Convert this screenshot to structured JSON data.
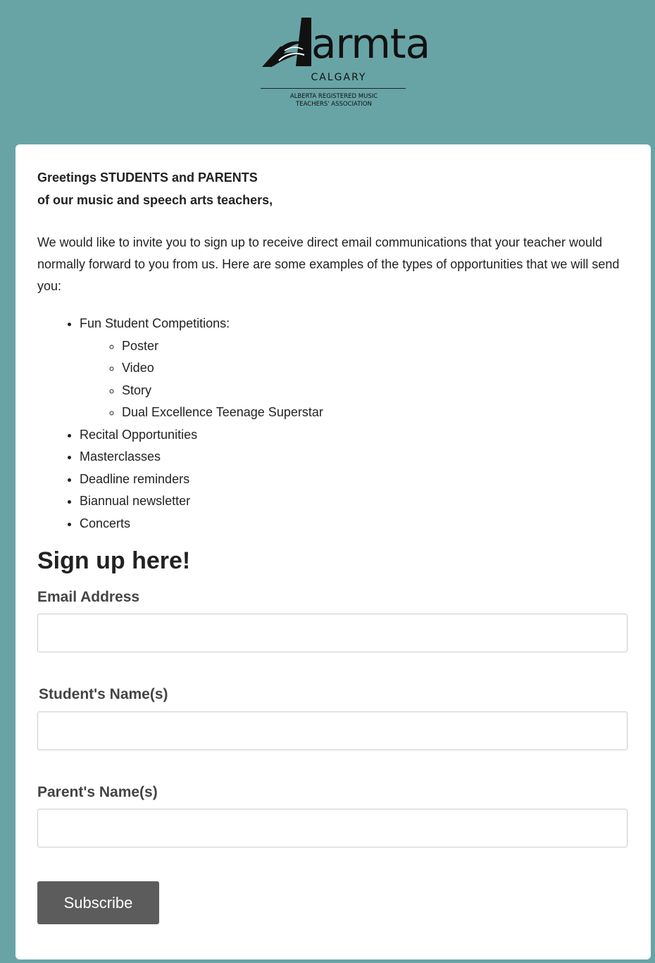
{
  "logo": {
    "wordmark": "armta",
    "city": "CALGARY",
    "association_line1": "ALBERTA REGISTERED MUSIC",
    "association_line2": "TEACHERS' ASSOCIATION",
    "icon": "armta-music-logo-icon"
  },
  "intro": {
    "greeting_line1": "Greetings STUDENTS and PARENTS",
    "greeting_line2": "of our music and speech arts teachers,",
    "paragraph": "We would like to invite you to sign up to receive direct email communications that your teacher would normally forward to you from us. Here are some examples of the types of opportunities that we will send you:"
  },
  "opportunities": {
    "competitions": {
      "label": "Fun Student Competitions:",
      "items": [
        "Poster",
        "Video",
        "Story",
        "Dual Excellence Teenage Superstar"
      ]
    },
    "items": [
      "Recital Opportunities",
      "Masterclasses",
      "Deadline reminders",
      "Biannual newsletter",
      "Concerts"
    ]
  },
  "form": {
    "title": "Sign up here!",
    "email": {
      "label": "Email Address",
      "value": "",
      "placeholder": ""
    },
    "student": {
      "label": "Student's Name(s)",
      "value": "",
      "placeholder": ""
    },
    "parent": {
      "label": "Parent's Name(s)",
      "value": "",
      "placeholder": ""
    },
    "subscribe_label": "Subscribe"
  },
  "colors": {
    "page_background": "#68a4a6",
    "card_background": "#ffffff",
    "button_background": "#5c5c5c",
    "button_text": "#ffffff"
  }
}
